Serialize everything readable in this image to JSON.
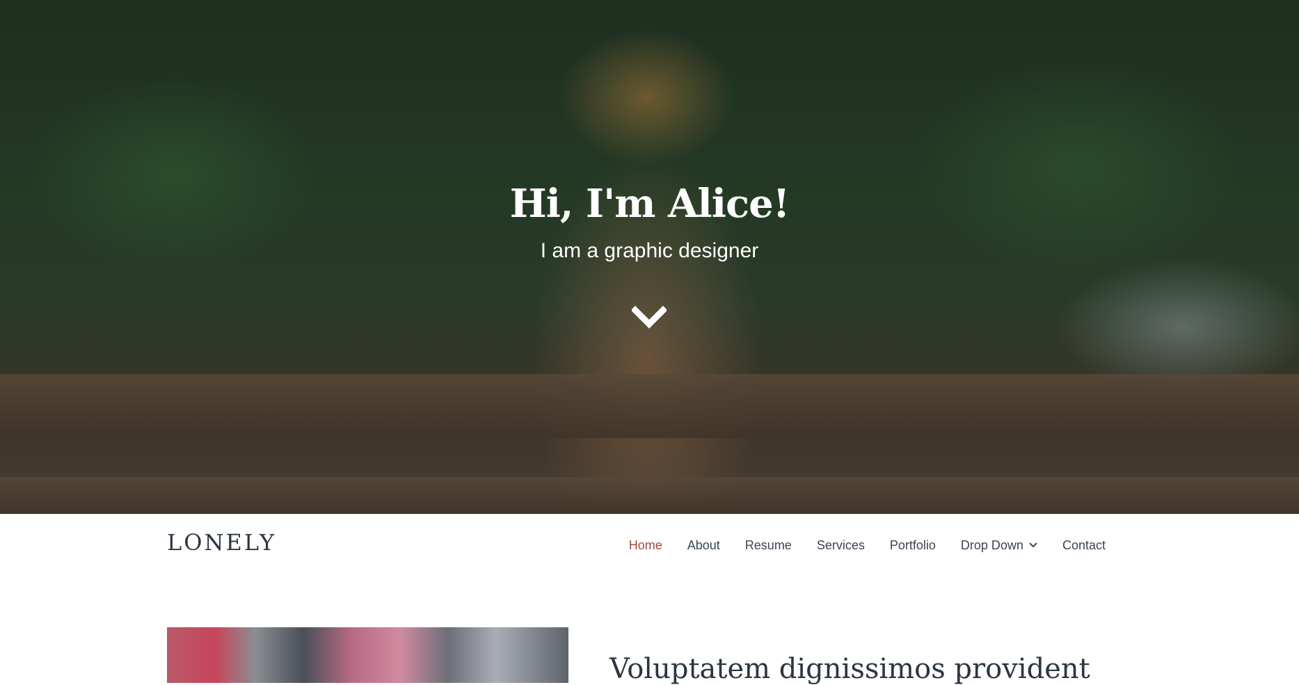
{
  "hero": {
    "title": "Hi, I'm Alice!",
    "subtitle": "I am a graphic designer",
    "scroll_icon": "chevron-down-icon"
  },
  "navbar": {
    "logo": "LONELY",
    "items": [
      {
        "label": "Home",
        "active": true
      },
      {
        "label": "About",
        "active": false
      },
      {
        "label": "Resume",
        "active": false
      },
      {
        "label": "Services",
        "active": false
      },
      {
        "label": "Portfolio",
        "active": false
      },
      {
        "label": "Drop Down",
        "active": false,
        "icon": "chevron-down-icon"
      },
      {
        "label": "Contact",
        "active": false
      }
    ]
  },
  "about": {
    "heading": "Voluptatem dignissimos provident"
  },
  "colors": {
    "accent": "#a5483c",
    "text_dark": "#2c3542",
    "nav_text": "#3a4452"
  }
}
